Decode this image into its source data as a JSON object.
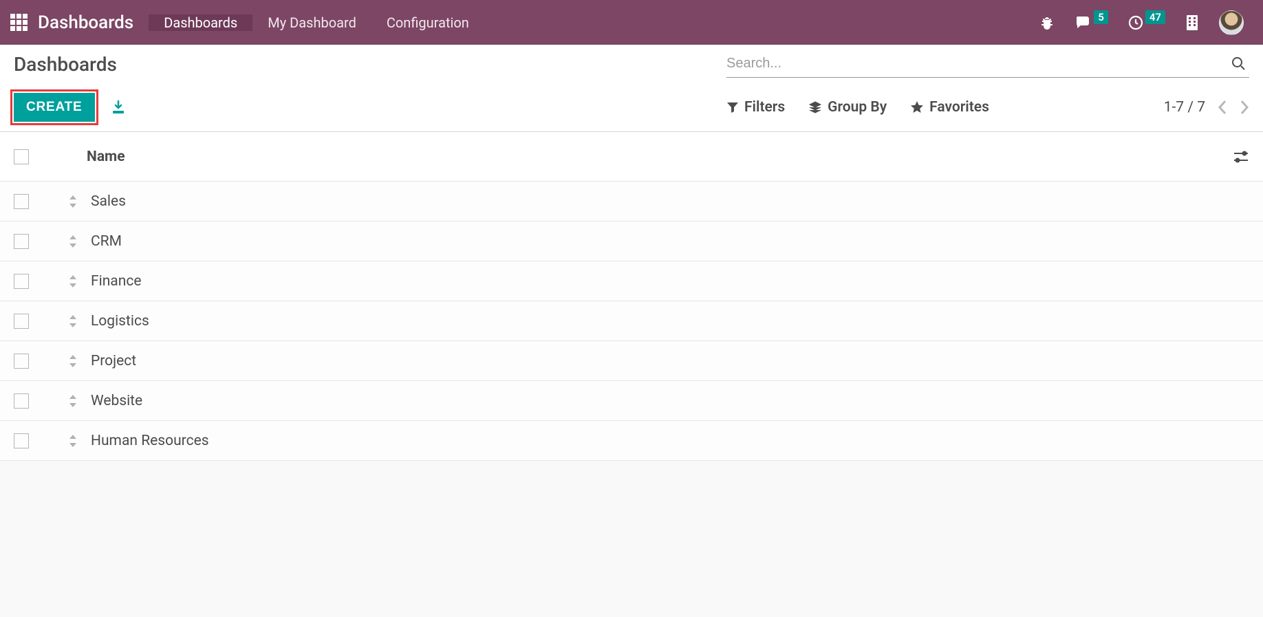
{
  "navbar": {
    "brand": "Dashboards",
    "menu": [
      {
        "label": "Dashboards",
        "active": true
      },
      {
        "label": "My Dashboard",
        "active": false
      },
      {
        "label": "Configuration",
        "active": false
      }
    ],
    "badges": {
      "messages": "5",
      "activities": "47"
    }
  },
  "control_panel": {
    "breadcrumb": "Dashboards",
    "search_placeholder": "Search...",
    "create_label": "CREATE",
    "filters_label": "Filters",
    "groupby_label": "Group By",
    "favorites_label": "Favorites",
    "pager": "1-7 / 7"
  },
  "list": {
    "column_header": "Name",
    "rows": [
      {
        "name": "Sales"
      },
      {
        "name": "CRM"
      },
      {
        "name": "Finance"
      },
      {
        "name": "Logistics"
      },
      {
        "name": "Project"
      },
      {
        "name": "Website"
      },
      {
        "name": "Human Resources"
      }
    ]
  },
  "colors": {
    "primary": "#00a09d",
    "navbar": "#7c4664",
    "navbar_active": "#6d3957",
    "highlight_outline": "#e63b3b"
  }
}
